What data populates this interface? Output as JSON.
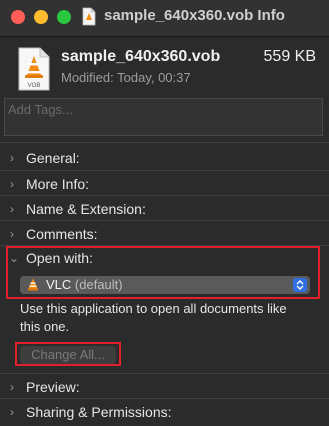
{
  "window": {
    "title": "sample_640x360.vob Info"
  },
  "file": {
    "name": "sample_640x360.vob",
    "size": "559 KB",
    "modified": "Modified: Today, 00:37",
    "icon_caption": "VOB"
  },
  "tags": {
    "placeholder": "Add Tags..."
  },
  "sections": {
    "general": "General:",
    "more_info": "More Info:",
    "name_extension": "Name & Extension:",
    "comments": "Comments:",
    "open_with": "Open with:",
    "preview": "Preview:",
    "sharing": "Sharing & Permissions:"
  },
  "open_with": {
    "app_name": "VLC",
    "app_default": "(default)",
    "description": "Use this application to open all documents like this one.",
    "change_all_label": "Change All..."
  },
  "colors": {
    "background": "#2b2b2b",
    "highlight": "#e0202a",
    "popup_accent": "#2f6fe0",
    "vlc_orange": "#f28c13"
  },
  "icons": [
    "vob-file-icon",
    "vlc-icon",
    "chevron-right-icon",
    "chevron-down-icon",
    "popup-stepper-icon"
  ]
}
